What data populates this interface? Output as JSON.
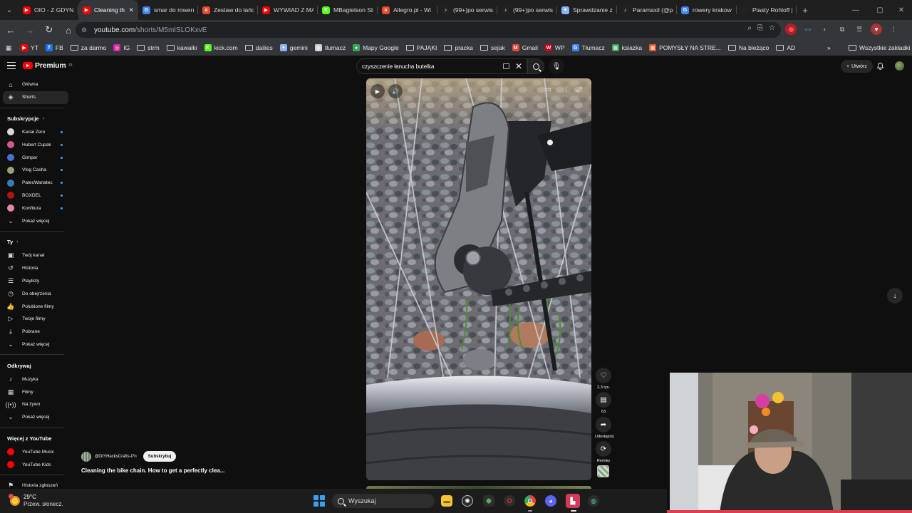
{
  "tabs": [
    {
      "label": "OIO - Z GDYNI",
      "fav_color": "#ff0000",
      "fav_glyph": "▶",
      "active": false
    },
    {
      "label": "Cleaning th",
      "fav_color": "#ff0000",
      "fav_glyph": "▶",
      "active": true
    },
    {
      "label": "smar do rowerı",
      "fav_color": "#4285f4",
      "fav_glyph": "G",
      "active": false
    },
    {
      "label": "Zestaw do łańc",
      "fav_color": "#e84b2c",
      "fav_glyph": "a",
      "active": false
    },
    {
      "label": "WYWIAD Z MA",
      "fav_color": "#ff0000",
      "fav_glyph": "▶",
      "active": false
    },
    {
      "label": "MBagietson Sti",
      "fav_color": "#53fc18",
      "fav_glyph": "K",
      "active": false
    },
    {
      "label": "Allegro.pl - Wi",
      "fav_color": "#e84b2c",
      "fav_glyph": "a",
      "active": false
    },
    {
      "label": "(99+)po serwis",
      "fav_color": "#222222",
      "fav_glyph": "♪",
      "active": false
    },
    {
      "label": "(99+)po serwis",
      "fav_color": "#222222",
      "fav_glyph": "♪",
      "active": false
    },
    {
      "label": "Sprawdzanie z",
      "fav_color": "#8ab4f8",
      "fav_glyph": "✦",
      "active": false
    },
    {
      "label": "Paramaxil (@p",
      "fav_color": "#222222",
      "fav_glyph": "♪",
      "active": false
    },
    {
      "label": "rowery krakow",
      "fav_color": "#4285f4",
      "fav_glyph": "G",
      "active": false
    },
    {
      "label": "Piasty Rohloff |",
      "fav_color": "#222222",
      "fav_glyph": "",
      "active": false
    }
  ],
  "address": {
    "host": "youtube.com",
    "path": "/shorts/M5mISLOKxvE"
  },
  "bookmarks": [
    {
      "label": "YT",
      "icon": "youtube",
      "color": "#ff0000",
      "glyph": "▶"
    },
    {
      "label": "FB",
      "icon": "facebook",
      "color": "#1877f2",
      "glyph": "f"
    },
    {
      "label": "za darmo",
      "icon": "folder"
    },
    {
      "label": "IG",
      "icon": "instagram",
      "color": "#d6249f",
      "glyph": "◎"
    },
    {
      "label": "strm",
      "icon": "folder"
    },
    {
      "label": "kawałki",
      "icon": "folder"
    },
    {
      "label": "kick.com",
      "icon": "kick",
      "color": "#53fc18",
      "glyph": "K"
    },
    {
      "label": "dailies",
      "icon": "folder"
    },
    {
      "label": "gemini",
      "icon": "gemini",
      "color": "#8ab4f8",
      "glyph": "✦"
    },
    {
      "label": "tłumacz",
      "icon": "translate",
      "color": "#cfcfcf",
      "glyph": "◍"
    },
    {
      "label": "Mapy Google",
      "icon": "maps",
      "color": "#34a853",
      "glyph": "●"
    },
    {
      "label": "PAJĄKI",
      "icon": "folder"
    },
    {
      "label": "pracka",
      "icon": "folder"
    },
    {
      "label": "sejak",
      "icon": "folder"
    },
    {
      "label": "Gmail",
      "icon": "gmail",
      "color": "#ea4335",
      "glyph": "M"
    },
    {
      "label": "WP",
      "icon": "wp",
      "color": "#d0021b",
      "glyph": "W"
    },
    {
      "label": "Tłumacz",
      "icon": "translate",
      "color": "#4285f4",
      "glyph": "G"
    },
    {
      "label": "ksiazka",
      "icon": "grid",
      "color": "#34a853",
      "glyph": "▦"
    },
    {
      "label": "POMYSŁY NA STRE...",
      "icon": "ms",
      "color": "#f25022",
      "glyph": "▦"
    },
    {
      "label": "Na bieżąco",
      "icon": "folder"
    },
    {
      "label": "AD",
      "icon": "folder"
    }
  ],
  "bookmarks_more": "»",
  "all_bookmarks": "Wszystkie zakładki",
  "youtube": {
    "logo_text": "Premium",
    "logo_region": "PL",
    "search_query": "czyszczenie łanucha butelka",
    "create_label": "Utwórz"
  },
  "sidebar": {
    "main": [
      {
        "label": "Główna",
        "icon": "home-icon",
        "glyph": "⌂"
      },
      {
        "label": "Shorts",
        "icon": "shorts-icon",
        "glyph": "◈",
        "active": true
      }
    ],
    "subs_header": "Subskrypcje",
    "subs": [
      {
        "label": "Kanał Zero",
        "color": "#d9d9d9"
      },
      {
        "label": "Hubert Cupak",
        "color": "#d8568f"
      },
      {
        "label": "Gimper",
        "color": "#4b6fd8"
      },
      {
        "label": "Vlog Casha",
        "color": "#9aa17b"
      },
      {
        "label": "PatecWariatec",
        "color": "#3a7bbf"
      },
      {
        "label": "BOXDEL",
        "color": "#b01414"
      },
      {
        "label": "Konfitura",
        "color": "#e38aa3"
      }
    ],
    "subs_more": "Pokaż więcej",
    "you_header": "Ty",
    "you": [
      {
        "label": "Twój kanał",
        "icon": "channel-icon",
        "glyph": "▣"
      },
      {
        "label": "Historia",
        "icon": "history-icon",
        "glyph": "↺"
      },
      {
        "label": "Playlisty",
        "icon": "playlist-icon",
        "glyph": "☰"
      },
      {
        "label": "Do obejrzenia",
        "icon": "watch-later-icon",
        "glyph": "◷"
      },
      {
        "label": "Polubione filmy",
        "icon": "like-icon",
        "glyph": "👍"
      },
      {
        "label": "Twoje filmy",
        "icon": "your-videos-icon",
        "glyph": "▷"
      },
      {
        "label": "Pobrane",
        "icon": "download-icon",
        "glyph": "⤓"
      }
    ],
    "you_more": "Pokaż więcej",
    "explore_header": "Odkrywaj",
    "explore": [
      {
        "label": "Muzyka",
        "icon": "music-icon",
        "glyph": "♪"
      },
      {
        "label": "Filmy",
        "icon": "movies-icon",
        "glyph": "▦"
      },
      {
        "label": "Na żywo",
        "icon": "live-icon",
        "glyph": "((•))"
      }
    ],
    "explore_more": "Pokaż więcej",
    "more_header": "Więcej z YouTube",
    "more": [
      {
        "label": "YouTube Music",
        "color": "#ff0000"
      },
      {
        "label": "YouTube Kids",
        "color": "#ff0000"
      }
    ],
    "report": "Historia zgłoszeń"
  },
  "short": {
    "channel": "@DIYHacksCrafts-l7n",
    "subscribe_label": "Subskrybuj",
    "title": "Cleaning the bike chain. How to get a perfectly clea...",
    "likes": "2,3 tys.",
    "comments": "63",
    "share_label": "Udostępnij",
    "remix_label": "Remiks"
  },
  "taskbar": {
    "temperature": "29°C",
    "weather": "Przew. słonecz.",
    "search_placeholder": "Wyszukaj"
  }
}
